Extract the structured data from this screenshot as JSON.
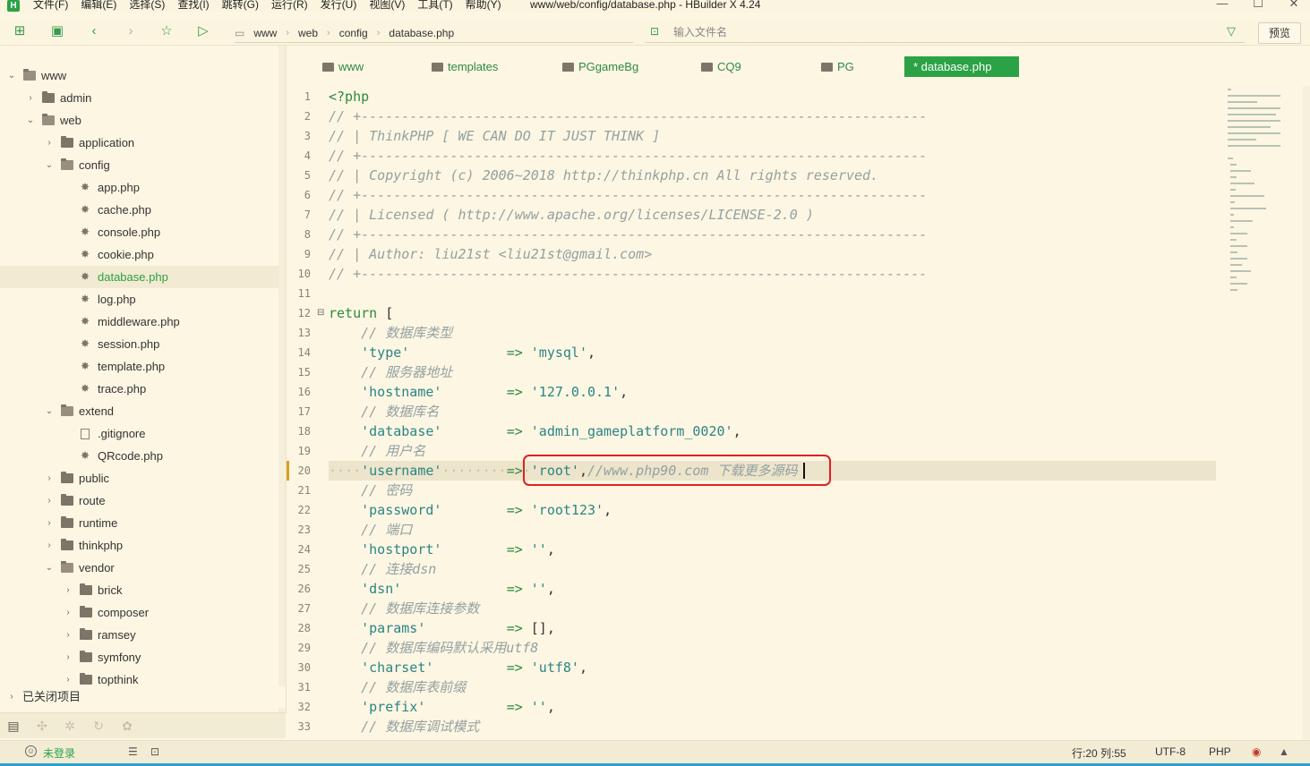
{
  "menu": {
    "items": [
      "文件(F)",
      "编辑(E)",
      "选择(S)",
      "查找(I)",
      "跳转(G)",
      "运行(R)",
      "发行(U)",
      "视图(V)",
      "工具(T)",
      "帮助(Y)"
    ],
    "window_title": "www/web/config/database.php - HBuilder X 4.24",
    "logo": "H"
  },
  "window_controls": {
    "minimize": "—",
    "maximize": "☐",
    "close": "✕"
  },
  "toolbar": {
    "breadcrumb": [
      "www",
      "web",
      "config",
      "database.php"
    ],
    "filter_placeholder": "输入文件名",
    "preview_label": "预览"
  },
  "sidebar": {
    "tree": [
      {
        "label": "www",
        "depth": 0,
        "kind": "folder",
        "state": "open"
      },
      {
        "label": "admin",
        "depth": 1,
        "kind": "folder",
        "state": "closed"
      },
      {
        "label": "web",
        "depth": 1,
        "kind": "folder",
        "state": "open"
      },
      {
        "label": "application",
        "depth": 2,
        "kind": "folder",
        "state": "closed"
      },
      {
        "label": "config",
        "depth": 2,
        "kind": "folder",
        "state": "open"
      },
      {
        "label": "app.php",
        "depth": 3,
        "kind": "php"
      },
      {
        "label": "cache.php",
        "depth": 3,
        "kind": "php"
      },
      {
        "label": "console.php",
        "depth": 3,
        "kind": "php"
      },
      {
        "label": "cookie.php",
        "depth": 3,
        "kind": "php"
      },
      {
        "label": "database.php",
        "depth": 3,
        "kind": "php",
        "selected": true
      },
      {
        "label": "log.php",
        "depth": 3,
        "kind": "php"
      },
      {
        "label": "middleware.php",
        "depth": 3,
        "kind": "php"
      },
      {
        "label": "session.php",
        "depth": 3,
        "kind": "php"
      },
      {
        "label": "template.php",
        "depth": 3,
        "kind": "php"
      },
      {
        "label": "trace.php",
        "depth": 3,
        "kind": "php"
      },
      {
        "label": "extend",
        "depth": 2,
        "kind": "folder",
        "state": "open"
      },
      {
        "label": ".gitignore",
        "depth": 3,
        "kind": "file"
      },
      {
        "label": "QRcode.php",
        "depth": 3,
        "kind": "php"
      },
      {
        "label": "public",
        "depth": 2,
        "kind": "folder",
        "state": "closed"
      },
      {
        "label": "route",
        "depth": 2,
        "kind": "folder",
        "state": "closed"
      },
      {
        "label": "runtime",
        "depth": 2,
        "kind": "folder",
        "state": "closed"
      },
      {
        "label": "thinkphp",
        "depth": 2,
        "kind": "folder",
        "state": "closed"
      },
      {
        "label": "vendor",
        "depth": 2,
        "kind": "folder",
        "state": "open"
      },
      {
        "label": "brick",
        "depth": 3,
        "kind": "folder",
        "state": "closed"
      },
      {
        "label": "composer",
        "depth": 3,
        "kind": "folder",
        "state": "closed"
      },
      {
        "label": "ramsey",
        "depth": 3,
        "kind": "folder",
        "state": "closed"
      },
      {
        "label": "symfony",
        "depth": 3,
        "kind": "folder",
        "state": "closed"
      },
      {
        "label": "topthink",
        "depth": 3,
        "kind": "folder",
        "state": "closed"
      }
    ],
    "closed_projects": "已关闭项目"
  },
  "editor": {
    "tabs": [
      {
        "label": "www",
        "active": false
      },
      {
        "label": "templates",
        "active": false
      },
      {
        "label": "PGgameBg",
        "active": false
      },
      {
        "label": "CQ9",
        "active": false
      },
      {
        "label": "PG",
        "active": false
      },
      {
        "label": "* database.php",
        "active": true
      }
    ],
    "current_line": 20,
    "lines": [
      [
        [
          "kw",
          "<?php"
        ]
      ],
      [
        [
          "com",
          "// +----------------------------------------------------------------------"
        ]
      ],
      [
        [
          "com",
          "// | ThinkPHP [ WE CAN DO IT JUST THINK ]"
        ]
      ],
      [
        [
          "com",
          "// +----------------------------------------------------------------------"
        ]
      ],
      [
        [
          "com",
          "// | Copyright (c) 2006~2018 http://thinkphp.cn All rights reserved."
        ]
      ],
      [
        [
          "com",
          "// +----------------------------------------------------------------------"
        ]
      ],
      [
        [
          "com",
          "// | Licensed ( http://www.apache.org/licenses/LICENSE-2.0 )"
        ]
      ],
      [
        [
          "com",
          "// +----------------------------------------------------------------------"
        ]
      ],
      [
        [
          "com",
          "// | Author: liu21st <liu21st@gmail.com>"
        ]
      ],
      [
        [
          "com",
          "// +----------------------------------------------------------------------"
        ]
      ],
      [],
      [
        [
          "kw",
          "return"
        ],
        [
          "pl",
          " ["
        ]
      ],
      [
        [
          "pl",
          "    "
        ],
        [
          "com",
          "// 数据库类型"
        ]
      ],
      [
        [
          "pl",
          "    "
        ],
        [
          "str",
          "'type'"
        ],
        [
          "pl",
          "            "
        ],
        [
          "op",
          "=>"
        ],
        [
          "pl",
          " "
        ],
        [
          "str",
          "'mysql'"
        ],
        [
          "pl",
          ","
        ]
      ],
      [
        [
          "pl",
          "    "
        ],
        [
          "com",
          "// 服务器地址"
        ]
      ],
      [
        [
          "pl",
          "    "
        ],
        [
          "str",
          "'hostname'"
        ],
        [
          "pl",
          "        "
        ],
        [
          "op",
          "=>"
        ],
        [
          "pl",
          " "
        ],
        [
          "str",
          "'127.0.0.1'"
        ],
        [
          "pl",
          ","
        ]
      ],
      [
        [
          "pl",
          "    "
        ],
        [
          "com",
          "// 数据库名"
        ]
      ],
      [
        [
          "pl",
          "    "
        ],
        [
          "str",
          "'database'"
        ],
        [
          "pl",
          "        "
        ],
        [
          "op",
          "=>"
        ],
        [
          "pl",
          " "
        ],
        [
          "str",
          "'admin_gameplatform_0020'"
        ],
        [
          "pl",
          ","
        ]
      ],
      [
        [
          "pl",
          "    "
        ],
        [
          "com",
          "// 用户名"
        ]
      ],
      [
        [
          "dots",
          "····"
        ],
        [
          "str",
          "'username'"
        ],
        [
          "dots",
          "········"
        ],
        [
          "op",
          "=>"
        ],
        [
          "dots",
          "·"
        ],
        [
          "str",
          "'root'"
        ],
        [
          "pl",
          ","
        ],
        [
          "com",
          "//www.php90.com 下载更多源码"
        ]
      ],
      [
        [
          "pl",
          "    "
        ],
        [
          "com",
          "// 密码"
        ]
      ],
      [
        [
          "pl",
          "    "
        ],
        [
          "str",
          "'password'"
        ],
        [
          "pl",
          "        "
        ],
        [
          "op",
          "=>"
        ],
        [
          "pl",
          " "
        ],
        [
          "str",
          "'root123'"
        ],
        [
          "pl",
          ","
        ]
      ],
      [
        [
          "pl",
          "    "
        ],
        [
          "com",
          "// 端口"
        ]
      ],
      [
        [
          "pl",
          "    "
        ],
        [
          "str",
          "'hostport'"
        ],
        [
          "pl",
          "        "
        ],
        [
          "op",
          "=>"
        ],
        [
          "pl",
          " "
        ],
        [
          "str",
          "''"
        ],
        [
          "pl",
          ","
        ]
      ],
      [
        [
          "pl",
          "    "
        ],
        [
          "com",
          "// 连接dsn"
        ]
      ],
      [
        [
          "pl",
          "    "
        ],
        [
          "str",
          "'dsn'"
        ],
        [
          "pl",
          "             "
        ],
        [
          "op",
          "=>"
        ],
        [
          "pl",
          " "
        ],
        [
          "str",
          "''"
        ],
        [
          "pl",
          ","
        ]
      ],
      [
        [
          "pl",
          "    "
        ],
        [
          "com",
          "// 数据库连接参数"
        ]
      ],
      [
        [
          "pl",
          "    "
        ],
        [
          "str",
          "'params'"
        ],
        [
          "pl",
          "          "
        ],
        [
          "op",
          "=>"
        ],
        [
          "pl",
          " [],"
        ]
      ],
      [
        [
          "pl",
          "    "
        ],
        [
          "com",
          "// 数据库编码默认采用utf8"
        ]
      ],
      [
        [
          "pl",
          "    "
        ],
        [
          "str",
          "'charset'"
        ],
        [
          "pl",
          "         "
        ],
        [
          "op",
          "=>"
        ],
        [
          "pl",
          " "
        ],
        [
          "str",
          "'utf8'"
        ],
        [
          "pl",
          ","
        ]
      ],
      [
        [
          "pl",
          "    "
        ],
        [
          "com",
          "// 数据库表前缀"
        ]
      ],
      [
        [
          "pl",
          "    "
        ],
        [
          "str",
          "'prefix'"
        ],
        [
          "pl",
          "          "
        ],
        [
          "op",
          "=>"
        ],
        [
          "pl",
          " "
        ],
        [
          "str",
          "''"
        ],
        [
          "pl",
          ","
        ]
      ],
      [
        [
          "pl",
          "    "
        ],
        [
          "com",
          "// 数据库调试模式"
        ]
      ]
    ]
  },
  "statusbar": {
    "login": "未登录",
    "position": "行:20  列:55",
    "encoding": "UTF-8",
    "language": "PHP"
  },
  "colors": {
    "accent": "#2ba245",
    "background": "#fdf6e3",
    "highlight_border": "#e02020"
  }
}
